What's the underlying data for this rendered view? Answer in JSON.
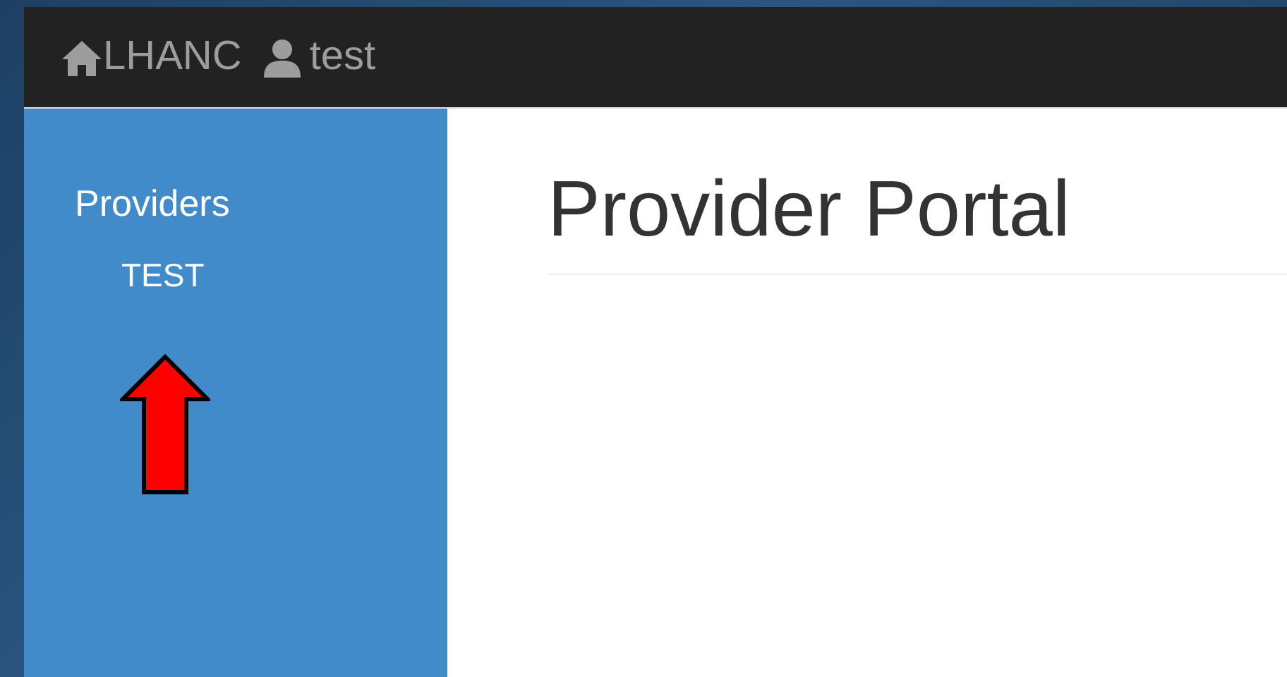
{
  "navbar": {
    "brand": "LHANC",
    "user": "test"
  },
  "sidebar": {
    "heading": "Providers",
    "items": [
      {
        "label": "TEST"
      }
    ]
  },
  "main": {
    "title": "Provider Portal"
  },
  "annotation": {
    "kind": "arrow"
  }
}
